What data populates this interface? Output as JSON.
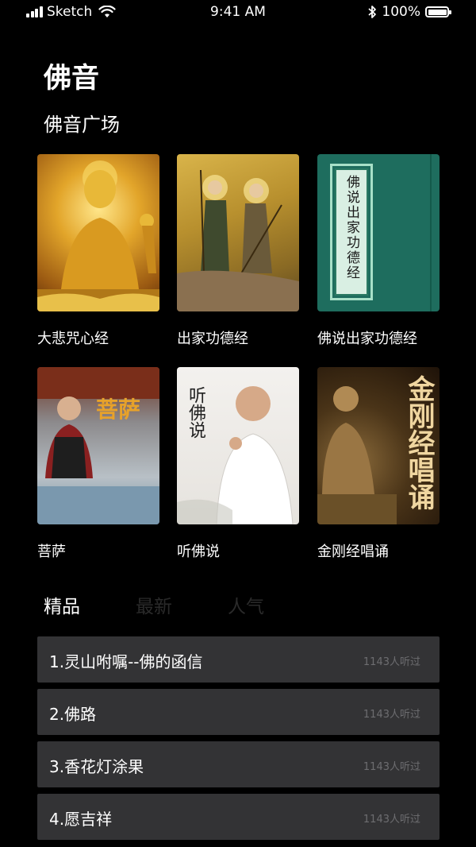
{
  "status_bar": {
    "carrier": "Sketch",
    "time": "9:41 AM",
    "battery": "100%"
  },
  "header": {
    "title": "佛音",
    "section_title": "佛音广场"
  },
  "albums": [
    {
      "label": "大悲咒心经",
      "cover_text": ""
    },
    {
      "label": "出家功德经",
      "cover_text": ""
    },
    {
      "label": "佛说出家功德经",
      "cover_text": "佛说出家功德经"
    },
    {
      "label": "菩萨",
      "cover_text": "菩萨"
    },
    {
      "label": "听佛说",
      "cover_text": "听佛说"
    },
    {
      "label": "金刚经唱诵",
      "cover_text": "金刚经唱诵"
    }
  ],
  "tabs": [
    {
      "label": "精品",
      "active": true
    },
    {
      "label": "最新",
      "active": false
    },
    {
      "label": "人气",
      "active": false
    }
  ],
  "tracks": [
    {
      "title": "1.灵山咐嘱--佛的函信",
      "listeners": "1143人听过"
    },
    {
      "title": "2.佛路",
      "listeners": "1143人听过"
    },
    {
      "title": "3.香花灯涂果",
      "listeners": "1143人听过"
    },
    {
      "title": "4.愿吉祥",
      "listeners": "1143人听过"
    }
  ],
  "colors": {
    "background": "#000000",
    "track_background": "#333335",
    "inactive_tab": "#2a2a2a",
    "listener_text": "#6d6d70"
  }
}
